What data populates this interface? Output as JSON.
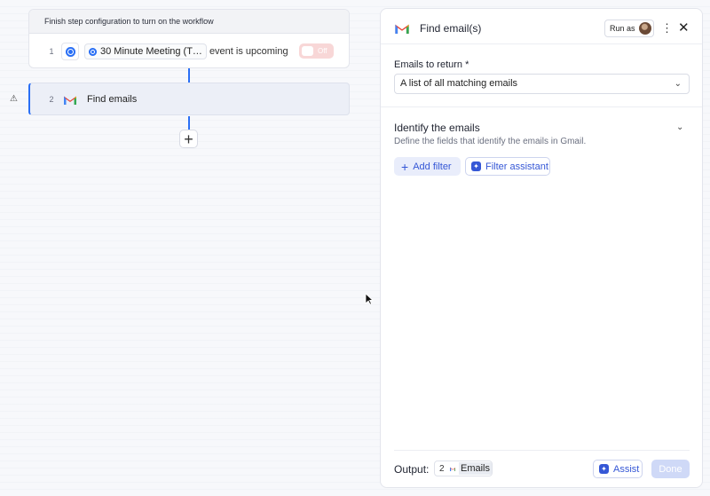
{
  "workflow": {
    "banner": "Finish step configuration to turn on the workflow",
    "step1": {
      "number": "1",
      "event_chip": "30 Minute Meeting (T…",
      "event_text": "event is upcoming",
      "toggle_label": "Off",
      "toggle_state": "off",
      "icon": "calendar-icon"
    },
    "step2": {
      "number": "2",
      "label": "Find emails",
      "icon": "gmail-icon",
      "warning_icon": "⚠"
    },
    "add_step_icon": "+"
  },
  "panel": {
    "title": "Find email(s)",
    "icon": "gmail-icon",
    "run_as_label": "Run as",
    "kebab": "⋮",
    "close": "✕",
    "emails_to_return": {
      "label": "Emails to return *",
      "value": "A list of all matching emails"
    },
    "identify": {
      "title": "Identify the emails",
      "description": "Define the fields that identify the emails in Gmail.",
      "add_filter_label": "Add filter",
      "filter_assistant_label": "Filter assistant"
    },
    "footer": {
      "output_label": "Output:",
      "output_step_number": "2",
      "output_name": "Emails",
      "assist_label": "Assist",
      "done_label": "Done"
    }
  },
  "colors": {
    "accent": "#2a6ff5",
    "button_text": "#3557d6",
    "toggle_off": "#f8d7d7",
    "done_disabled": "#cfd9f7"
  }
}
